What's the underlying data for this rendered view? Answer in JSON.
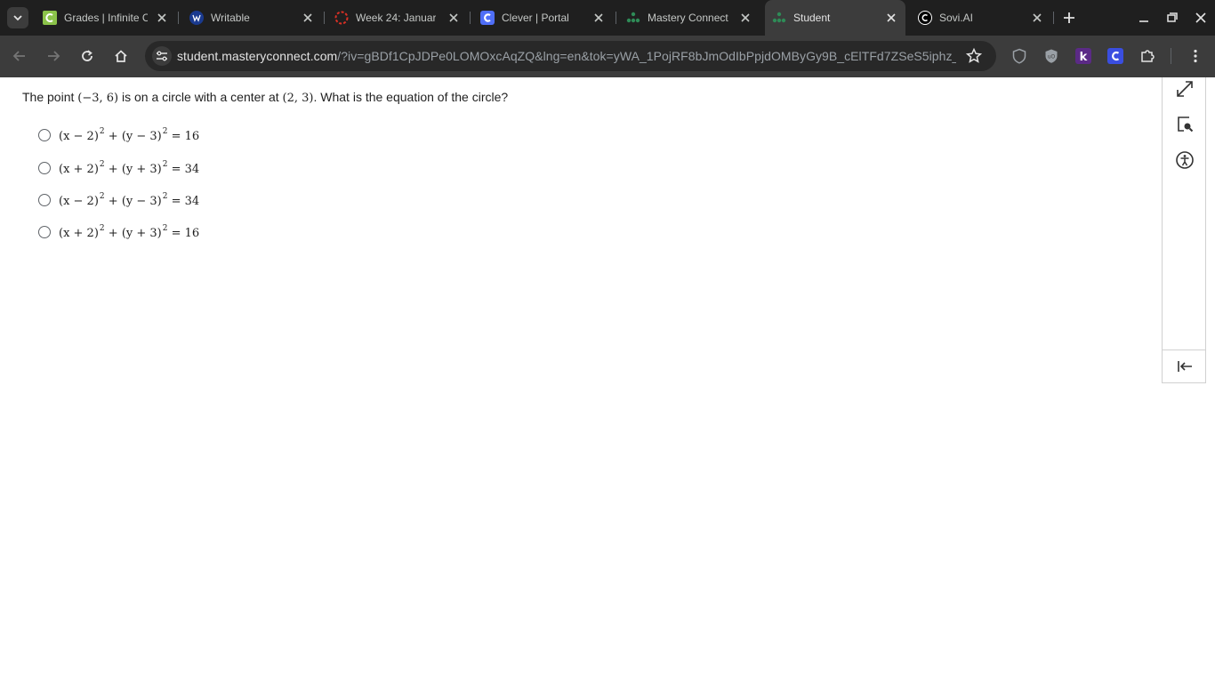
{
  "tabs": [
    {
      "title": "Grades | Infinite C",
      "favicon": "infinite-campus-icon",
      "active": false
    },
    {
      "title": "Writable",
      "favicon": "writable-icon",
      "active": false
    },
    {
      "title": "Week 24: Januar",
      "favicon": "loading-spinner-icon",
      "active": false
    },
    {
      "title": "Clever | Portal",
      "favicon": "clever-icon",
      "active": false
    },
    {
      "title": "Mastery Connect",
      "favicon": "mastery-connect-icon",
      "active": false
    },
    {
      "title": "Student",
      "favicon": "mastery-connect-icon",
      "active": true
    },
    {
      "title": "Sovi.AI",
      "favicon": "sovi-icon",
      "active": false
    }
  ],
  "toolbar": {
    "url_host": "student.masteryconnect.com",
    "url_rest": "/?iv=gBDf1CpJDPe0LOMOxcAqZQ&lng=en&tok=yWA_1PojRF8bJmOdIbPpjdOMByGy9B_cElTFd7ZSeS5iphz_..."
  },
  "question": {
    "prefix": "The point ",
    "point": "(−3, 6)",
    "middle": " is on a circle with a center at ",
    "center": "(2, 3)",
    "suffix": ". What is the equation of the circle?"
  },
  "choices": [
    {
      "x_part": "(x − 2)",
      "y_part": "(y − 3)",
      "exp": "2",
      "rhs": "16"
    },
    {
      "x_part": "(x + 2)",
      "y_part": "(y + 3)",
      "exp": "2",
      "rhs": "34"
    },
    {
      "x_part": "(x − 2)",
      "y_part": "(y − 3)",
      "exp": "2",
      "rhs": "34"
    },
    {
      "x_part": "(x + 2)",
      "y_part": "(y + 3)",
      "exp": "2",
      "rhs": "16"
    }
  ],
  "colors": {
    "tab_strip": "#1f1f1f",
    "toolbar": "#3c3c3c",
    "omnibox": "#282828",
    "mastery_green": "#2e8b57",
    "clever_blue": "#4f6ef7"
  }
}
